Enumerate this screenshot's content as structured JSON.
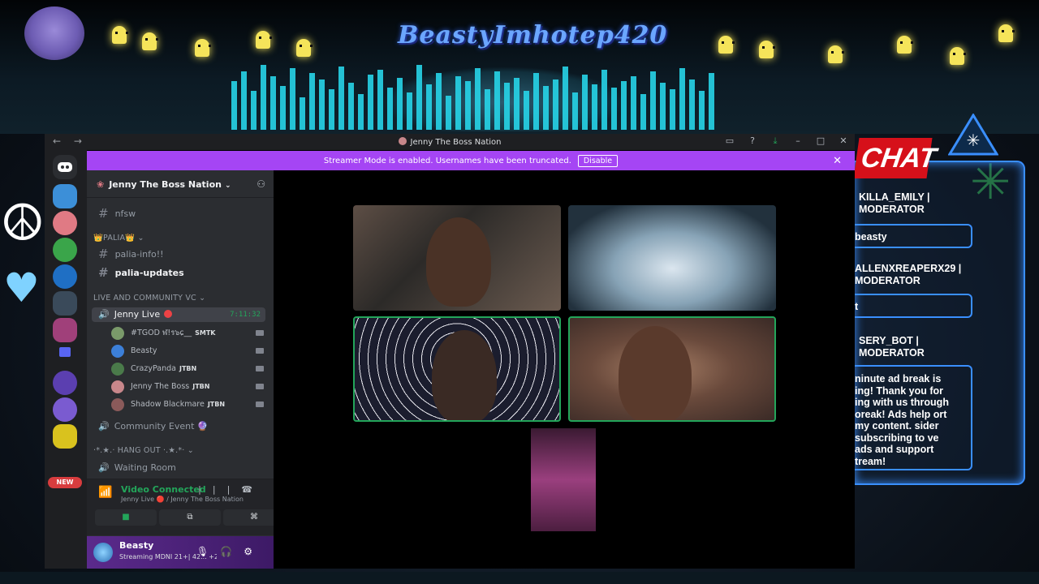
{
  "overlay": {
    "brand_title": "BeastyImhotep420",
    "chat_header": "CHAT",
    "chat_messages": [
      {
        "user": "KILLA_EMILY | MODERATOR"
      },
      {
        "text": "beasty"
      },
      {
        "user": "ALLENXREAPERX29 | MODERATOR"
      },
      {
        "text": "t"
      },
      {
        "user": "SERY_BOT | MODERATOR"
      },
      {
        "text": "ninute ad break is ing! Thank you for ing with us through oreak! Ads help ort my content. sider subscribing to ve ads and support tream!"
      }
    ]
  },
  "window": {
    "title": "Jenny The Boss Nation",
    "nav": "← →"
  },
  "banner": {
    "text": "Streamer Mode is enabled. Usernames have been truncated.",
    "button": "Disable",
    "close": "✕"
  },
  "rail": {
    "new_badge": "NEW"
  },
  "server": {
    "name": "Jenny The Boss Nation",
    "channels": [
      {
        "name": "nfsw"
      },
      {
        "name": "palia-info!!"
      },
      {
        "name": "palia-updates"
      }
    ],
    "category_palia": "👑PALIA👑",
    "category_live": "LIVE AND COMMUNITY VC",
    "voice_live": {
      "name": "Jenny Live",
      "timer": "7:11:32"
    },
    "participants": [
      {
        "name": "#TGOD ฬ!ร๖ɕ__",
        "tag": "SMTK"
      },
      {
        "name": "Beasty",
        "tag": ""
      },
      {
        "name": "CrazyPanda",
        "tag": "JTBN"
      },
      {
        "name": "Jenny The Boss",
        "tag": "JTBN"
      },
      {
        "name": "Shadow Blackmare",
        "tag": "JTBN"
      }
    ],
    "community_event": "Community Event 🔮",
    "category_hangout": "·*.★.·  HANG OUT ·.★.*·",
    "waiting_room": "Waiting Room"
  },
  "voice": {
    "status": "Video Connected",
    "sub": "Jenny Live 🔴 / Jenny The Boss Nation"
  },
  "user": {
    "name": "Beasty",
    "status": "Streaming MDNI 21+| 42...",
    "extra": "+2"
  }
}
